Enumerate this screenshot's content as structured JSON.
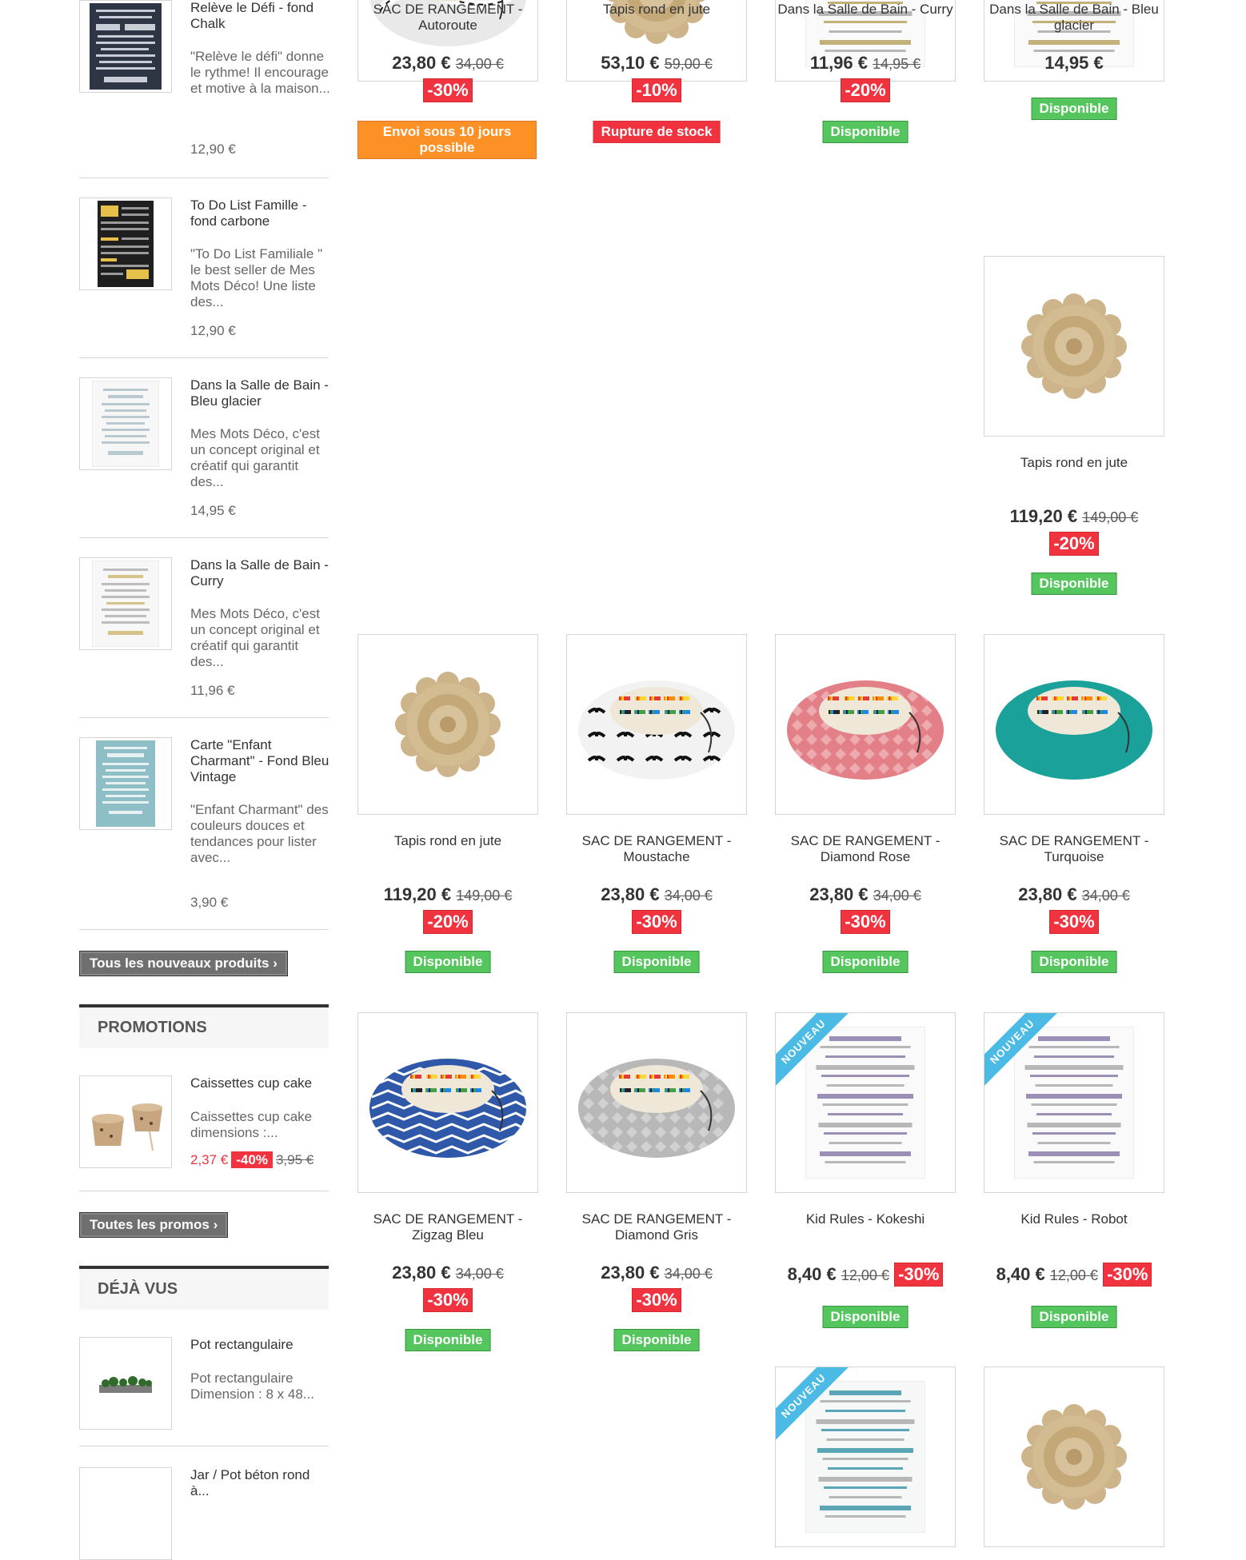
{
  "sidebar": {
    "new_products": [
      {
        "title": "Relève le Défi - fond Chalk",
        "desc": "\"Relève le défi\" donne le rythme! Il encourage et motive à la maison...",
        "price": "12,90 €",
        "thumb": "poster-dark"
      },
      {
        "title": "To Do List Famille - fond carbone",
        "desc": "\"To Do List Familiale \" le best seller de Mes Mots Déco! Une liste des...",
        "price": "12,90 €",
        "thumb": "poster-dark"
      },
      {
        "title": "Dans la Salle de Bain - Bleu glacier",
        "desc": "Mes Mots Déco, c'est un concept original et créatif qui garantit des...",
        "price": "14,95 €",
        "thumb": "poster-light"
      },
      {
        "title": "Dans la Salle de Bain - Curry",
        "desc": "Mes Mots Déco, c'est un concept original et créatif qui garantit des...",
        "price": "11,96 €",
        "thumb": "poster-light"
      },
      {
        "title": "Carte \"Enfant Charmant\" - Fond Bleu Vintage",
        "desc": "\"Enfant Charmant\" des couleurs douces et tendances pour lister avec...",
        "price": "3,90 €",
        "thumb": "card-blue"
      }
    ],
    "all_new_button": "Tous les nouveaux produits",
    "promotions": {
      "heading": "PROMOTIONS",
      "item": {
        "title": "Caissettes cup cake",
        "desc": "Caissettes cup cake dimensions :...",
        "new_price": "2,37 €",
        "discount": "-40%",
        "old_price": "3,95 €"
      },
      "all_button": "Toutes les promos"
    },
    "viewed": {
      "heading": "DÉJÀ VUS",
      "items": [
        {
          "title": "Pot rectangulaire",
          "desc": "Pot rectangulaire Dimension : 8 x 48..."
        },
        {
          "title": "Jar / Pot béton rond à..."
        }
      ]
    }
  },
  "products": [
    {
      "name": "SAC DE RANGEMENT - Autoroute",
      "price": "23,80 €",
      "old_price": "34,00 €",
      "discount": "-30%",
      "status": "Envoi sous 10 jours possible",
      "status_type": "envoi",
      "image": "bag-black"
    },
    {
      "name": "Tapis rond en jute",
      "price": "53,10 €",
      "old_price": "59,00 €",
      "discount": "-10%",
      "status": "Rupture de stock",
      "status_type": "rupture",
      "image": "jute"
    },
    {
      "name": "Dans la Salle de Bain - Curry",
      "price": "11,96 €",
      "old_price": "14,95 €",
      "discount": "-20%",
      "status": "Disponible",
      "status_type": "dispo",
      "image": "poster"
    },
    {
      "name": "Dans la Salle de Bain - Bleu glacier",
      "price": "14,95 €",
      "status": "Disponible",
      "status_type": "dispo",
      "image": "poster"
    },
    {
      "name": "Tapis rond en jute",
      "price": "119,20 €",
      "old_price": "149,00 €",
      "discount": "-20%",
      "status": "Disponible",
      "status_type": "dispo",
      "image": "jute"
    },
    {
      "name": "Tapis rond en jute",
      "price": "119,20 €",
      "old_price": "149,00 €",
      "discount": "-20%",
      "status": "Disponible",
      "status_type": "dispo",
      "image": "jute"
    },
    {
      "name": "SAC DE RANGEMENT - Moustache",
      "price": "23,80 €",
      "old_price": "34,00 €",
      "discount": "-30%",
      "status": "Disponible",
      "status_type": "dispo",
      "image": "bag-white"
    },
    {
      "name": "SAC DE RANGEMENT - Diamond Rose",
      "price": "23,80 €",
      "old_price": "34,00 €",
      "discount": "-30%",
      "status": "Disponible",
      "status_type": "dispo",
      "image": "bag-pink"
    },
    {
      "name": "SAC DE RANGEMENT - Turquoise",
      "price": "23,80 €",
      "old_price": "34,00 €",
      "discount": "-30%",
      "status": "Disponible",
      "status_type": "dispo",
      "image": "bag-teal"
    },
    {
      "name": "SAC DE RANGEMENT - Zigzag Bleu",
      "price": "23,80 €",
      "old_price": "34,00 €",
      "discount": "-30%",
      "status": "Disponible",
      "status_type": "dispo",
      "image": "bag-blue"
    },
    {
      "name": "SAC DE RANGEMENT - Diamond Gris",
      "price": "23,80 €",
      "old_price": "34,00 €",
      "discount": "-30%",
      "status": "Disponible",
      "status_type": "dispo",
      "image": "bag-grey"
    },
    {
      "name": "Kid Rules - Kokeshi",
      "price": "8,40 €",
      "old_price": "12,00 €",
      "discount": "-30%",
      "status": "Disponible",
      "status_type": "dispo",
      "image": "kid",
      "ribbon": "NOUVEAU"
    },
    {
      "name": "Kid Rules - Robot",
      "price": "8,40 €",
      "old_price": "12,00 €",
      "discount": "-30%",
      "status": "Disponible",
      "status_type": "dispo",
      "image": "kid",
      "ribbon": "NOUVEAU"
    },
    {
      "name": "",
      "image": "poster-blue",
      "ribbon": "NOUVEAU"
    },
    {
      "name": "",
      "image": "jute"
    }
  ],
  "colors": {
    "available": "#55c65e",
    "out_of_stock": "#f13340",
    "shipping": "#fe9126",
    "discount": "#f13340",
    "ribbon": "#4bbbe6"
  }
}
